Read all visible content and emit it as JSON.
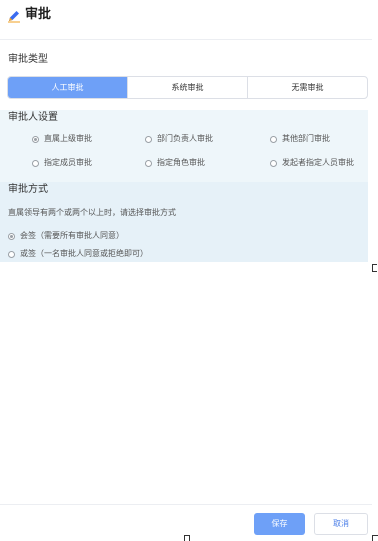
{
  "header": {
    "title": "审批"
  },
  "approval_type": {
    "label": "审批类型",
    "options": [
      "人工审批",
      "系统审批",
      "无需审批"
    ],
    "selected": "人工审批"
  },
  "approver_settings": {
    "title": "审批人设置",
    "options": [
      "直属上级审批",
      "部门负责人审批",
      "其他部门审批",
      "指定成员审批",
      "指定角色审批",
      "发起者指定人员审批"
    ],
    "selected": "直属上级审批"
  },
  "approval_method": {
    "title": "审批方式",
    "hint": "直属领导有两个或两个以上时，请选择审批方式",
    "options": [
      "会签（需要所有审批人同意）",
      "或签（一名审批人同意或拒绝即可）"
    ],
    "selected": "会签（需要所有审批人同意）"
  },
  "footer": {
    "save_label": "保存",
    "cancel_label": "取消"
  },
  "colors": {
    "primary": "#6ea0f7",
    "panel_bg": "#eef6fa",
    "panel_bg_2": "#e6f1f8"
  }
}
